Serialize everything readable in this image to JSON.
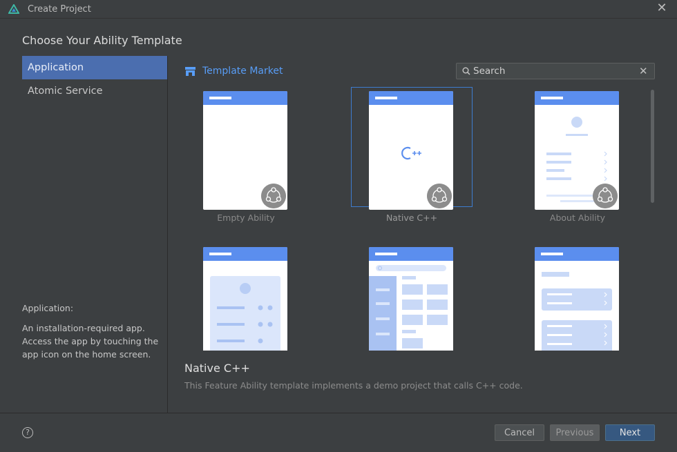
{
  "window": {
    "title": "Create Project"
  },
  "heading": "Choose Your Ability Template",
  "sidebar": {
    "items": [
      {
        "label": "Application",
        "active": true
      },
      {
        "label": "Atomic Service",
        "active": false
      }
    ]
  },
  "description": {
    "title": "Application:",
    "text": "An installation-required app. Access the app by touching the app icon on the home screen."
  },
  "market": {
    "label": "Template Market"
  },
  "search": {
    "value": "",
    "placeholder": "Search"
  },
  "templates": [
    {
      "label": "Empty Ability",
      "selected": false
    },
    {
      "label": "Native C++",
      "selected": true
    },
    {
      "label": "About Ability",
      "selected": false
    },
    {
      "label": "",
      "selected": false
    },
    {
      "label": "",
      "selected": false
    },
    {
      "label": "",
      "selected": false
    }
  ],
  "selected_template": {
    "name": "Native C++",
    "description": "This Feature Ability template implements a demo project that calls C++ code."
  },
  "footer": {
    "help": "?",
    "cancel": "Cancel",
    "previous": "Previous",
    "next": "Next"
  },
  "colors": {
    "accent": "#4b6eaf",
    "link": "#589df6",
    "thumb_bar": "#5b8eee",
    "selected_border": "#3d7dd0"
  }
}
